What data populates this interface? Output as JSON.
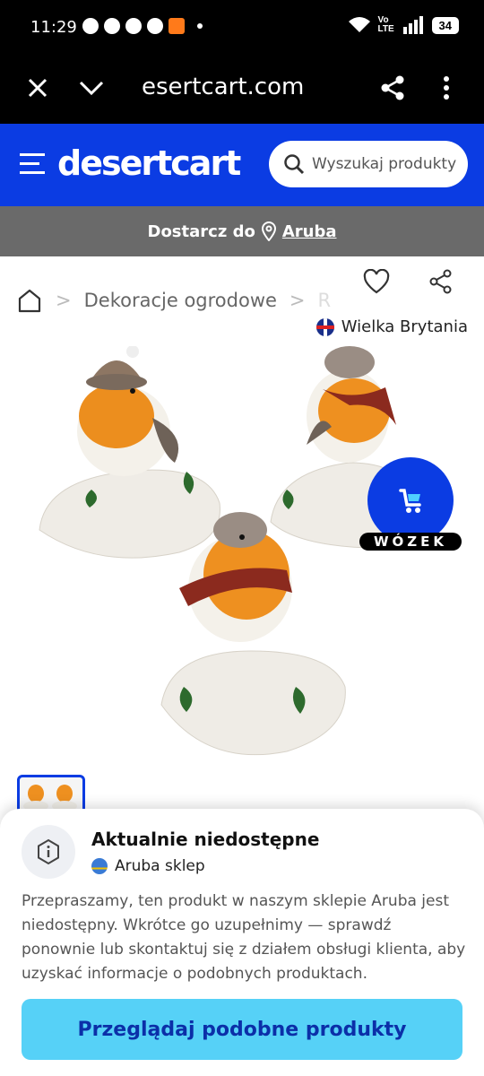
{
  "status_bar": {
    "time": "11:29",
    "network_label": "Vo LTE",
    "battery": "34",
    "icons": [
      "whatsapp-icon",
      "facebook-icon",
      "chat-icon",
      "messenger-icon",
      "temu-icon",
      "wifi-icon",
      "signal-icon"
    ]
  },
  "browser": {
    "url": "esertcart.com",
    "icons": [
      "close-icon",
      "chevron-down-icon",
      "share-icon",
      "more-vert-icon"
    ]
  },
  "header": {
    "logo": "desertcart",
    "search_placeholder": "Wyszukaj produkty",
    "accent": "#0b3ce3"
  },
  "delivery": {
    "label": "Dostarcz do",
    "location": "Aruba"
  },
  "breadcrumb": {
    "items": [
      "Dekoracje ogrodowe",
      "R"
    ]
  },
  "origin": {
    "label": "Wielka Brytania"
  },
  "cart": {
    "label": "WÓZEK"
  },
  "sheet": {
    "title": "Aktualnie niedostępne",
    "store": "Aruba sklep",
    "message": "Przepraszamy, ten produkt w naszym sklepie Aruba jest niedostępny. Wkrótce go uzupełnimy — sprawdź ponownie lub skontaktuj się z działem obsługi klienta, aby uzyskać informacje o podobnych produktach.",
    "button": "Przeglądaj podobne produkty",
    "button_color": "#56d1f7"
  }
}
